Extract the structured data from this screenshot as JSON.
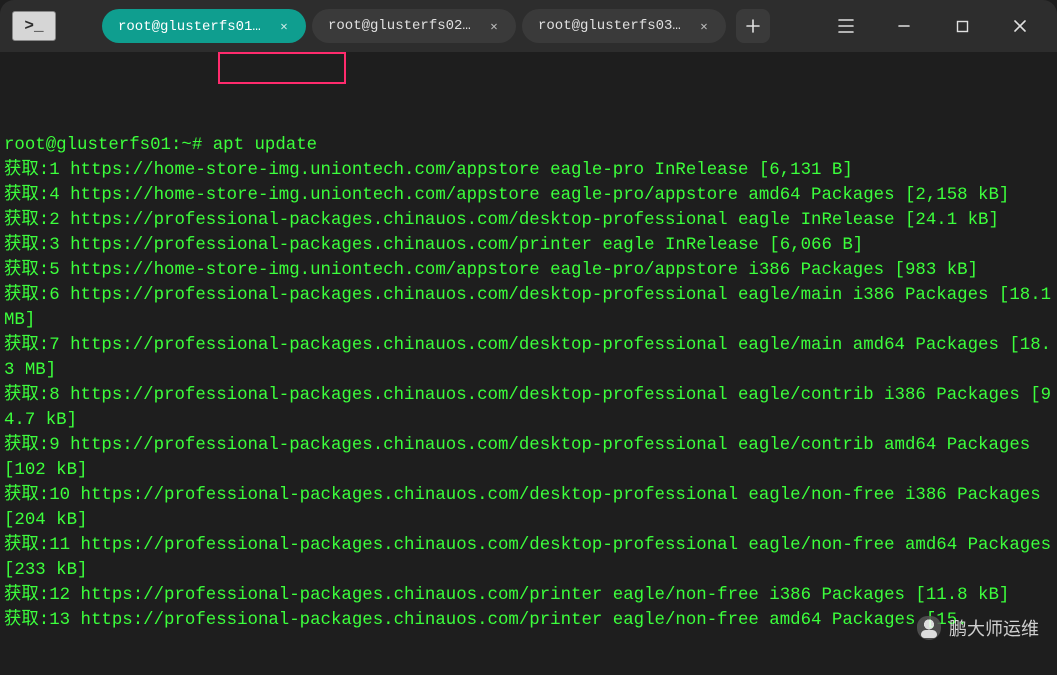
{
  "tabs": [
    {
      "label": "root@glusterfs01: ‥",
      "active": true
    },
    {
      "label": "root@glusterfs02: …",
      "active": false
    },
    {
      "label": "root@glusterfs03: …",
      "active": false
    }
  ],
  "prompt": "root@glusterfs01:~# ",
  "command": "apt update",
  "lines": [
    "获取:1 https://home-store-img.uniontech.com/appstore eagle-pro InRelease [6,131 B]",
    "获取:4 https://home-store-img.uniontech.com/appstore eagle-pro/appstore amd64 Packages [2,158 kB]",
    "获取:2 https://professional-packages.chinauos.com/desktop-professional eagle InRelease [24.1 kB]",
    "获取:3 https://professional-packages.chinauos.com/printer eagle InRelease [6,066 B]",
    "获取:5 https://home-store-img.uniontech.com/appstore eagle-pro/appstore i386 Packages [983 kB]",
    "获取:6 https://professional-packages.chinauos.com/desktop-professional eagle/main i386 Packages [18.1 MB]",
    "获取:7 https://professional-packages.chinauos.com/desktop-professional eagle/main amd64 Packages [18.3 MB]",
    "获取:8 https://professional-packages.chinauos.com/desktop-professional eagle/contrib i386 Packages [94.7 kB]",
    "获取:9 https://professional-packages.chinauos.com/desktop-professional eagle/contrib amd64 Packages [102 kB]",
    "获取:10 https://professional-packages.chinauos.com/desktop-professional eagle/non-free i386 Packages [204 kB]",
    "获取:11 https://professional-packages.chinauos.com/desktop-professional eagle/non-free amd64 Packages [233 kB]",
    "获取:12 https://professional-packages.chinauos.com/printer eagle/non-free i386 Packages [11.8 kB]",
    "获取:13 https://professional-packages.chinauos.com/printer eagle/non-free amd64 Packages [15."
  ],
  "watermark": "鹏大师运维"
}
